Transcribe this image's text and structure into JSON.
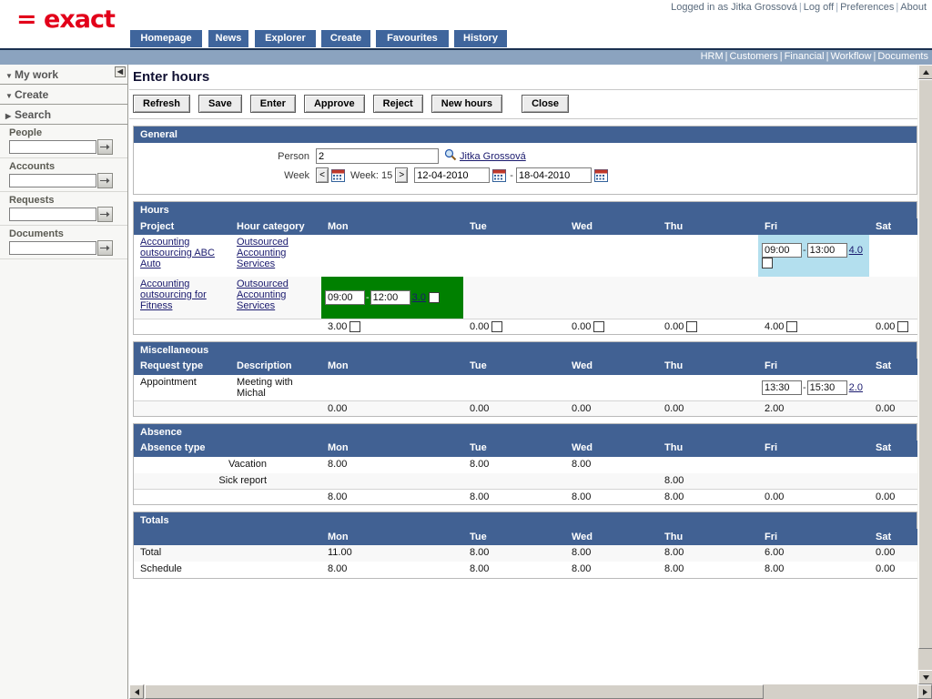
{
  "header": {
    "logo_text": "= exact",
    "logged_in_text": "Logged in as Jitka Grossová",
    "links": [
      {
        "label": "Log off"
      },
      {
        "label": "Preferences"
      },
      {
        "label": "About"
      }
    ],
    "nav_tabs": [
      {
        "label": "Homepage"
      },
      {
        "label": "News"
      },
      {
        "label": "Explorer"
      },
      {
        "label": "Create"
      },
      {
        "label": "Favourites"
      },
      {
        "label": "History"
      }
    ],
    "subnav_links": [
      {
        "label": "HRM"
      },
      {
        "label": "Customers"
      },
      {
        "label": "Financial"
      },
      {
        "label": "Workflow"
      },
      {
        "label": "Documents"
      }
    ]
  },
  "sidebar": {
    "sections": [
      {
        "label": "My work",
        "expanded": true
      },
      {
        "label": "Create",
        "expanded": true
      },
      {
        "label": "Search",
        "expanded": false
      }
    ],
    "search_fields": [
      {
        "label": "People",
        "value": "",
        "placeholder": ""
      },
      {
        "label": "Accounts",
        "value": "",
        "placeholder": ""
      },
      {
        "label": "Requests",
        "value": "",
        "placeholder": ""
      },
      {
        "label": "Documents",
        "value": "",
        "placeholder": ""
      }
    ]
  },
  "page": {
    "title": "Enter hours",
    "toolbar": [
      {
        "label": "Refresh"
      },
      {
        "label": "Save"
      },
      {
        "label": "Enter"
      },
      {
        "label": "Approve"
      },
      {
        "label": "Reject"
      },
      {
        "label": "New hours"
      },
      {
        "label": "Close"
      }
    ]
  },
  "general": {
    "panel_title": "General",
    "person_label": "Person",
    "person_value": "2",
    "person_name": "Jitka Grossová",
    "week_label": "Week",
    "prev_label": "<",
    "next_label": ">",
    "week_text": "Week: 15",
    "date_from": "12-04-2010",
    "date_to": "18-04-2010",
    "date_sep": "-"
  },
  "hours": {
    "panel_title": "Hours",
    "columns": [
      "Project",
      "Hour category",
      "Mon",
      "Tue",
      "Wed",
      "Thu",
      "Fri",
      "Sat"
    ],
    "rows": [
      {
        "project": "Accounting outsourcing ABC Auto",
        "category": "Outsourced Accounting Services",
        "days": {
          "Mon": {
            "type": "empty"
          },
          "Tue": {
            "type": "empty"
          },
          "Wed": {
            "type": "empty"
          },
          "Thu": {
            "type": "empty"
          },
          "Fri": {
            "type": "entry",
            "from": "09:00",
            "to": "13:00",
            "total": "4.0",
            "checked": false,
            "highlight": "blue"
          },
          "Sat": {
            "type": "empty"
          }
        }
      },
      {
        "project": "Accounting outsourcing for Fitness",
        "category": "Outsourced Accounting Services",
        "days": {
          "Mon": {
            "type": "entry",
            "from": "09:00",
            "to": "12:00",
            "total": "3.0",
            "checked": false,
            "highlight": "green"
          },
          "Tue": {
            "type": "empty"
          },
          "Wed": {
            "type": "empty"
          },
          "Thu": {
            "type": "empty"
          },
          "Fri": {
            "type": "empty"
          },
          "Sat": {
            "type": "empty"
          }
        }
      }
    ],
    "totals": {
      "Mon": "3.00",
      "Tue": "0.00",
      "Wed": "0.00",
      "Thu": "0.00",
      "Fri": "4.00",
      "Sat": "0.00"
    }
  },
  "miscellaneous": {
    "panel_title": "Miscellaneous",
    "columns": [
      "Request type",
      "Description",
      "Mon",
      "Tue",
      "Wed",
      "Thu",
      "Fri",
      "Sat"
    ],
    "rows": [
      {
        "request_type": "Appointment",
        "description": "Meeting with Michal",
        "days": {
          "Mon": {
            "type": "empty"
          },
          "Tue": {
            "type": "empty"
          },
          "Wed": {
            "type": "empty"
          },
          "Thu": {
            "type": "empty"
          },
          "Fri": {
            "type": "entry",
            "from": "13:30",
            "to": "15:30",
            "total": "2.0"
          },
          "Sat": {
            "type": "empty"
          }
        }
      }
    ],
    "totals": {
      "Mon": "0.00",
      "Tue": "0.00",
      "Wed": "0.00",
      "Thu": "0.00",
      "Fri": "2.00",
      "Sat": "0.00"
    }
  },
  "absence": {
    "panel_title": "Absence",
    "columns": [
      "Absence type",
      "Mon",
      "Tue",
      "Wed",
      "Thu",
      "Fri",
      "Sat"
    ],
    "rows": [
      {
        "type": "Vacation",
        "Mon": "8.00",
        "Tue": "8.00",
        "Wed": "8.00",
        "Thu": "",
        "Fri": "",
        "Sat": ""
      },
      {
        "type": "Sick report",
        "Mon": "",
        "Tue": "",
        "Wed": "",
        "Thu": "8.00",
        "Fri": "",
        "Sat": ""
      }
    ],
    "totals": {
      "Mon": "8.00",
      "Tue": "8.00",
      "Wed": "8.00",
      "Thu": "8.00",
      "Fri": "0.00",
      "Sat": "0.00"
    }
  },
  "totals": {
    "panel_title": "Totals",
    "columns": [
      "",
      "Mon",
      "Tue",
      "Wed",
      "Thu",
      "Fri",
      "Sat"
    ],
    "rows": [
      {
        "label": "Total",
        "Mon": "11.00",
        "Tue": "8.00",
        "Wed": "8.00",
        "Thu": "8.00",
        "Fri": "6.00",
        "Sat": "0.00"
      },
      {
        "label": "Schedule",
        "Mon": "8.00",
        "Tue": "8.00",
        "Wed": "8.00",
        "Thu": "8.00",
        "Fri": "8.00",
        "Sat": "0.00"
      }
    ]
  },
  "colors": {
    "brand_red": "#e2001a",
    "nav_blue": "#3f659c",
    "panel_blue": "#416193",
    "subnav_blue": "#8ba3bf",
    "cell_green": "#008000",
    "cell_blue": "#b3dfee"
  }
}
